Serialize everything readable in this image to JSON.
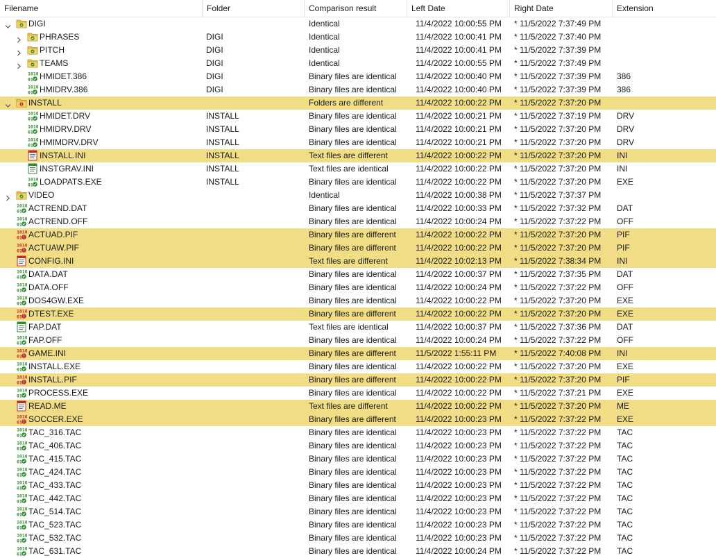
{
  "columns": [
    "Filename",
    "Folder",
    "Comparison result",
    "Left Date",
    "Right Date",
    "Extension"
  ],
  "rows": [
    {
      "level": 0,
      "expander": "open",
      "icon": "folder",
      "name": "DIGI",
      "folder": "",
      "result": "Identical",
      "left": "11/4/2022 10:00:55 PM",
      "right": "* 11/5/2022 7:37:49 PM",
      "ext": "",
      "diff": false
    },
    {
      "level": 1,
      "expander": "closed",
      "icon": "folder",
      "name": "PHRASES",
      "folder": "DIGI",
      "result": "Identical",
      "left": "11/4/2022 10:00:41 PM",
      "right": "* 11/5/2022 7:37:40 PM",
      "ext": "",
      "diff": false
    },
    {
      "level": 1,
      "expander": "closed",
      "icon": "folder",
      "name": "PITCH",
      "folder": "DIGI",
      "result": "Identical",
      "left": "11/4/2022 10:00:41 PM",
      "right": "* 11/5/2022 7:37:39 PM",
      "ext": "",
      "diff": false
    },
    {
      "level": 1,
      "expander": "closed",
      "icon": "folder",
      "name": "TEAMS",
      "folder": "DIGI",
      "result": "Identical",
      "left": "11/4/2022 10:00:55 PM",
      "right": "* 11/5/2022 7:37:49 PM",
      "ext": "",
      "diff": false
    },
    {
      "level": 1,
      "expander": "none",
      "icon": "binary-same",
      "name": "HMIDET.386",
      "folder": "DIGI",
      "result": "Binary files are identical",
      "left": "11/4/2022 10:00:40 PM",
      "right": "* 11/5/2022 7:37:39 PM",
      "ext": "386",
      "diff": false
    },
    {
      "level": 1,
      "expander": "none",
      "icon": "binary-same",
      "name": "HMIDRV.386",
      "folder": "DIGI",
      "result": "Binary files are identical",
      "left": "11/4/2022 10:00:40 PM",
      "right": "* 11/5/2022 7:37:39 PM",
      "ext": "386",
      "diff": false
    },
    {
      "level": 0,
      "expander": "open",
      "icon": "folder-diff",
      "name": "INSTALL",
      "folder": "",
      "result": "Folders are different",
      "left": "11/4/2022 10:00:22 PM",
      "right": "* 11/5/2022 7:37:20 PM",
      "ext": "",
      "diff": true
    },
    {
      "level": 1,
      "expander": "none",
      "icon": "binary-same",
      "name": "HMIDET.DRV",
      "folder": "INSTALL",
      "result": "Binary files are identical",
      "left": "11/4/2022 10:00:21 PM",
      "right": "* 11/5/2022 7:37:19 PM",
      "ext": "DRV",
      "diff": false
    },
    {
      "level": 1,
      "expander": "none",
      "icon": "binary-same",
      "name": "HMIDRV.DRV",
      "folder": "INSTALL",
      "result": "Binary files are identical",
      "left": "11/4/2022 10:00:21 PM",
      "right": "* 11/5/2022 7:37:20 PM",
      "ext": "DRV",
      "diff": false
    },
    {
      "level": 1,
      "expander": "none",
      "icon": "binary-same",
      "name": "HMIMDRV.DRV",
      "folder": "INSTALL",
      "result": "Binary files are identical",
      "left": "11/4/2022 10:00:21 PM",
      "right": "* 11/5/2022 7:37:20 PM",
      "ext": "DRV",
      "diff": false
    },
    {
      "level": 1,
      "expander": "none",
      "icon": "text-diff",
      "name": "INSTALL.INI",
      "folder": "INSTALL",
      "result": "Text files are different",
      "left": "11/4/2022 10:00:22 PM",
      "right": "* 11/5/2022 7:37:20 PM",
      "ext": "INI",
      "diff": true
    },
    {
      "level": 1,
      "expander": "none",
      "icon": "text-same",
      "name": "INSTGRAV.INI",
      "folder": "INSTALL",
      "result": "Text files are identical",
      "left": "11/4/2022 10:00:22 PM",
      "right": "* 11/5/2022 7:37:20 PM",
      "ext": "INI",
      "diff": false
    },
    {
      "level": 1,
      "expander": "none",
      "icon": "binary-same",
      "name": "LOADPATS.EXE",
      "folder": "INSTALL",
      "result": "Binary files are identical",
      "left": "11/4/2022 10:00:22 PM",
      "right": "* 11/5/2022 7:37:20 PM",
      "ext": "EXE",
      "diff": false
    },
    {
      "level": 0,
      "expander": "closed",
      "icon": "folder",
      "name": "VIDEO",
      "folder": "",
      "result": "Identical",
      "left": "11/4/2022 10:00:38 PM",
      "right": "* 11/5/2022 7:37:37 PM",
      "ext": "",
      "diff": false
    },
    {
      "level": 0,
      "expander": "none",
      "icon": "binary-same",
      "name": "ACTREND.DAT",
      "folder": "",
      "result": "Binary files are identical",
      "left": "11/4/2022 10:00:33 PM",
      "right": "* 11/5/2022 7:37:32 PM",
      "ext": "DAT",
      "diff": false
    },
    {
      "level": 0,
      "expander": "none",
      "icon": "binary-same",
      "name": "ACTREND.OFF",
      "folder": "",
      "result": "Binary files are identical",
      "left": "11/4/2022 10:00:24 PM",
      "right": "* 11/5/2022 7:37:22 PM",
      "ext": "OFF",
      "diff": false
    },
    {
      "level": 0,
      "expander": "none",
      "icon": "binary-diff",
      "name": "ACTUAD.PIF",
      "folder": "",
      "result": "Binary files are different",
      "left": "11/4/2022 10:00:22 PM",
      "right": "* 11/5/2022 7:37:20 PM",
      "ext": "PIF",
      "diff": true
    },
    {
      "level": 0,
      "expander": "none",
      "icon": "binary-diff",
      "name": "ACTUAW.PIF",
      "folder": "",
      "result": "Binary files are different",
      "left": "11/4/2022 10:00:22 PM",
      "right": "* 11/5/2022 7:37:20 PM",
      "ext": "PIF",
      "diff": true
    },
    {
      "level": 0,
      "expander": "none",
      "icon": "text-diff",
      "name": "CONFIG.INI",
      "folder": "",
      "result": "Text files are different",
      "left": "11/4/2022 10:02:13 PM",
      "right": "* 11/5/2022 7:38:34 PM",
      "ext": "INI",
      "diff": true
    },
    {
      "level": 0,
      "expander": "none",
      "icon": "binary-same",
      "name": "DATA.DAT",
      "folder": "",
      "result": "Binary files are identical",
      "left": "11/4/2022 10:00:37 PM",
      "right": "* 11/5/2022 7:37:35 PM",
      "ext": "DAT",
      "diff": false
    },
    {
      "level": 0,
      "expander": "none",
      "icon": "binary-same",
      "name": "DATA.OFF",
      "folder": "",
      "result": "Binary files are identical",
      "left": "11/4/2022 10:00:24 PM",
      "right": "* 11/5/2022 7:37:22 PM",
      "ext": "OFF",
      "diff": false
    },
    {
      "level": 0,
      "expander": "none",
      "icon": "binary-same",
      "name": "DOS4GW.EXE",
      "folder": "",
      "result": "Binary files are identical",
      "left": "11/4/2022 10:00:22 PM",
      "right": "* 11/5/2022 7:37:20 PM",
      "ext": "EXE",
      "diff": false
    },
    {
      "level": 0,
      "expander": "none",
      "icon": "binary-diff",
      "name": "DTEST.EXE",
      "folder": "",
      "result": "Binary files are different",
      "left": "11/4/2022 10:00:22 PM",
      "right": "* 11/5/2022 7:37:20 PM",
      "ext": "EXE",
      "diff": true
    },
    {
      "level": 0,
      "expander": "none",
      "icon": "text-same",
      "name": "FAP.DAT",
      "folder": "",
      "result": "Text files are identical",
      "left": "11/4/2022 10:00:37 PM",
      "right": "* 11/5/2022 7:37:36 PM",
      "ext": "DAT",
      "diff": false
    },
    {
      "level": 0,
      "expander": "none",
      "icon": "binary-same",
      "name": "FAP.OFF",
      "folder": "",
      "result": "Binary files are identical",
      "left": "11/4/2022 10:00:24 PM",
      "right": "* 11/5/2022 7:37:22 PM",
      "ext": "OFF",
      "diff": false
    },
    {
      "level": 0,
      "expander": "none",
      "icon": "binary-diff",
      "name": "GAME.INI",
      "folder": "",
      "result": "Binary files are different",
      "left": "11/5/2022 1:55:11 PM",
      "right": "* 11/5/2022 7:40:08 PM",
      "ext": "INI",
      "diff": true
    },
    {
      "level": 0,
      "expander": "none",
      "icon": "binary-same",
      "name": "INSTALL.EXE",
      "folder": "",
      "result": "Binary files are identical",
      "left": "11/4/2022 10:00:22 PM",
      "right": "* 11/5/2022 7:37:20 PM",
      "ext": "EXE",
      "diff": false
    },
    {
      "level": 0,
      "expander": "none",
      "icon": "binary-diff",
      "name": "INSTALL.PIF",
      "folder": "",
      "result": "Binary files are different",
      "left": "11/4/2022 10:00:22 PM",
      "right": "* 11/5/2022 7:37:20 PM",
      "ext": "PIF",
      "diff": true
    },
    {
      "level": 0,
      "expander": "none",
      "icon": "binary-same",
      "name": "PROCESS.EXE",
      "folder": "",
      "result": "Binary files are identical",
      "left": "11/4/2022 10:00:22 PM",
      "right": "* 11/5/2022 7:37:21 PM",
      "ext": "EXE",
      "diff": false
    },
    {
      "level": 0,
      "expander": "none",
      "icon": "text-diff",
      "name": "READ.ME",
      "folder": "",
      "result": "Text files are different",
      "left": "11/4/2022 10:00:22 PM",
      "right": "* 11/5/2022 7:37:20 PM",
      "ext": "ME",
      "diff": true
    },
    {
      "level": 0,
      "expander": "none",
      "icon": "binary-diff",
      "name": "SOCCER.EXE",
      "folder": "",
      "result": "Binary files are different",
      "left": "11/4/2022 10:00:23 PM",
      "right": "* 11/5/2022 7:37:22 PM",
      "ext": "EXE",
      "diff": true
    },
    {
      "level": 0,
      "expander": "none",
      "icon": "binary-same",
      "name": "TAC_316.TAC",
      "folder": "",
      "result": "Binary files are identical",
      "left": "11/4/2022 10:00:23 PM",
      "right": "* 11/5/2022 7:37:22 PM",
      "ext": "TAC",
      "diff": false
    },
    {
      "level": 0,
      "expander": "none",
      "icon": "binary-same",
      "name": "TAC_406.TAC",
      "folder": "",
      "result": "Binary files are identical",
      "left": "11/4/2022 10:00:23 PM",
      "right": "* 11/5/2022 7:37:22 PM",
      "ext": "TAC",
      "diff": false
    },
    {
      "level": 0,
      "expander": "none",
      "icon": "binary-same",
      "name": "TAC_415.TAC",
      "folder": "",
      "result": "Binary files are identical",
      "left": "11/4/2022 10:00:23 PM",
      "right": "* 11/5/2022 7:37:22 PM",
      "ext": "TAC",
      "diff": false
    },
    {
      "level": 0,
      "expander": "none",
      "icon": "binary-same",
      "name": "TAC_424.TAC",
      "folder": "",
      "result": "Binary files are identical",
      "left": "11/4/2022 10:00:23 PM",
      "right": "* 11/5/2022 7:37:22 PM",
      "ext": "TAC",
      "diff": false
    },
    {
      "level": 0,
      "expander": "none",
      "icon": "binary-same",
      "name": "TAC_433.TAC",
      "folder": "",
      "result": "Binary files are identical",
      "left": "11/4/2022 10:00:23 PM",
      "right": "* 11/5/2022 7:37:22 PM",
      "ext": "TAC",
      "diff": false
    },
    {
      "level": 0,
      "expander": "none",
      "icon": "binary-same",
      "name": "TAC_442.TAC",
      "folder": "",
      "result": "Binary files are identical",
      "left": "11/4/2022 10:00:23 PM",
      "right": "* 11/5/2022 7:37:22 PM",
      "ext": "TAC",
      "diff": false
    },
    {
      "level": 0,
      "expander": "none",
      "icon": "binary-same",
      "name": "TAC_514.TAC",
      "folder": "",
      "result": "Binary files are identical",
      "left": "11/4/2022 10:00:23 PM",
      "right": "* 11/5/2022 7:37:22 PM",
      "ext": "TAC",
      "diff": false
    },
    {
      "level": 0,
      "expander": "none",
      "icon": "binary-same",
      "name": "TAC_523.TAC",
      "folder": "",
      "result": "Binary files are identical",
      "left": "11/4/2022 10:00:23 PM",
      "right": "* 11/5/2022 7:37:22 PM",
      "ext": "TAC",
      "diff": false
    },
    {
      "level": 0,
      "expander": "none",
      "icon": "binary-same",
      "name": "TAC_532.TAC",
      "folder": "",
      "result": "Binary files are identical",
      "left": "11/4/2022 10:00:23 PM",
      "right": "* 11/5/2022 7:37:22 PM",
      "ext": "TAC",
      "diff": false
    },
    {
      "level": 0,
      "expander": "none",
      "icon": "binary-same",
      "name": "TAC_631.TAC",
      "folder": "",
      "result": "Binary files are identical",
      "left": "11/4/2022 10:00:24 PM",
      "right": "* 11/5/2022 7:37:22 PM",
      "ext": "TAC",
      "diff": false
    }
  ],
  "colors": {
    "diff_row": "#f0dd85",
    "folder": "#e8c54a",
    "folder_dark": "#b8901c",
    "binary_same": "#2c8c2c",
    "binary_diff": "#c62828",
    "text_doc": "#ffffff"
  }
}
